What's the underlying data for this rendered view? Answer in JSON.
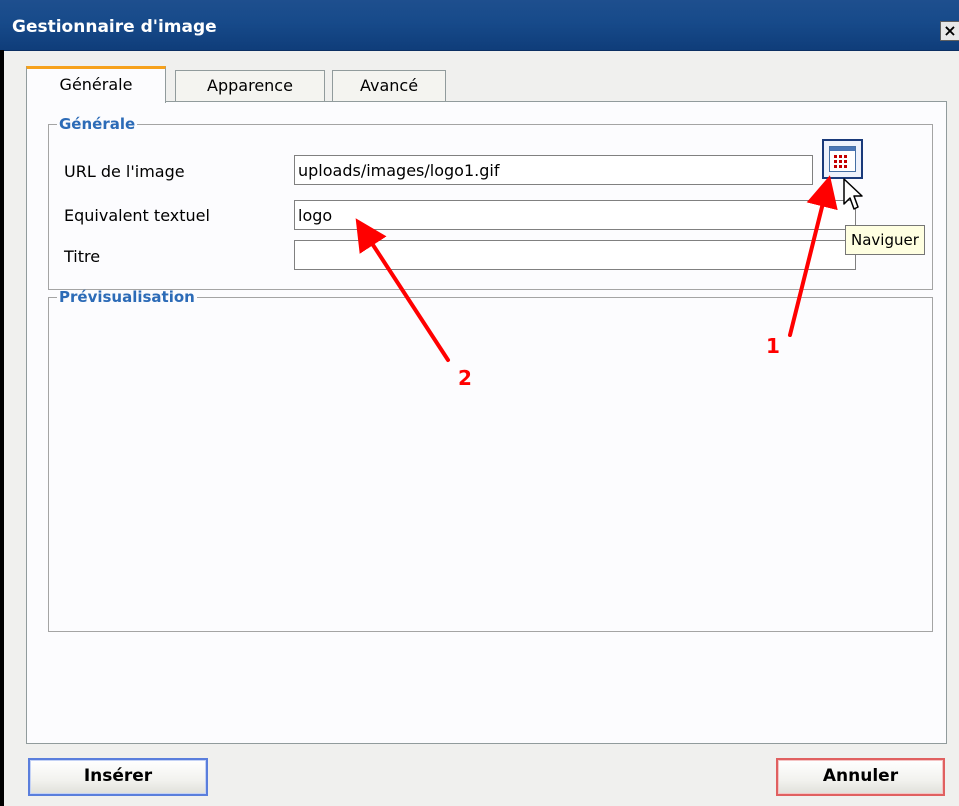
{
  "window": {
    "title": "Gestionnaire d'image",
    "close_label": "×"
  },
  "tabs": [
    {
      "label": "Générale",
      "active": true
    },
    {
      "label": "Apparence",
      "active": false
    },
    {
      "label": "Avancé",
      "active": false
    }
  ],
  "general_section": {
    "legend": "Générale",
    "url_label": "URL de l'image",
    "url_value": "uploads/images/logo1.gif",
    "alt_label": "Equivalent textuel",
    "alt_value": "logo",
    "title_label": "Titre",
    "title_value": ""
  },
  "browse": {
    "icon": "browse-icon",
    "tooltip": "Naviguer"
  },
  "preview_section": {
    "legend": "Prévisualisation"
  },
  "annotations": [
    {
      "label": "1",
      "color": "#ff0000"
    },
    {
      "label": "2",
      "color": "#ff0000"
    }
  ],
  "buttons": {
    "insert": "Insérer",
    "cancel": "Annuler"
  },
  "colors": {
    "titlebar": "#174a8a",
    "active_tab_accent": "#f6a11b",
    "legend_text": "#2c6bb7",
    "insert_border": "#5a7edc",
    "cancel_border": "#e06060",
    "annotation": "#ff0000"
  }
}
